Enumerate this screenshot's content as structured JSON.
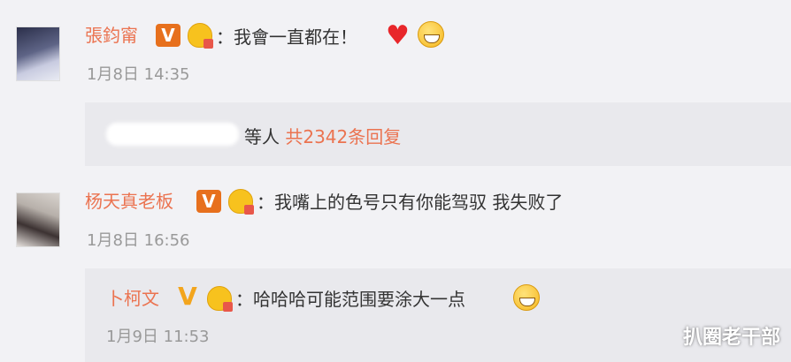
{
  "comments": [
    {
      "username": "張鈞甯",
      "text": "：我會一直都在！",
      "time": "1月8日 14:35",
      "badge": "V",
      "reply_summary": {
        "suffix": "等人",
        "count_link": "共2342条回复"
      }
    },
    {
      "username": "杨天真老板",
      "text": "：我嘴上的色号只有你能驾驭 我失败了",
      "time": "1月8日 16:56",
      "badge": "V",
      "reply": {
        "username": "卜柯文",
        "text": "：哈哈哈可能范围要涂大一点",
        "time": "1月9日 11:53",
        "badge": "V"
      }
    }
  ],
  "watermark": "扒圈老干部",
  "colors": {
    "username": "#eb7350",
    "text": "#333333",
    "time": "#999999",
    "background": "#f2f2f5",
    "reply_background": "#e9e9ed"
  },
  "icons": [
    "verified-v-icon",
    "vip-crown-icon",
    "heart-emoji-icon",
    "grin-emoji-icon",
    "thinking-emoji-icon"
  ]
}
